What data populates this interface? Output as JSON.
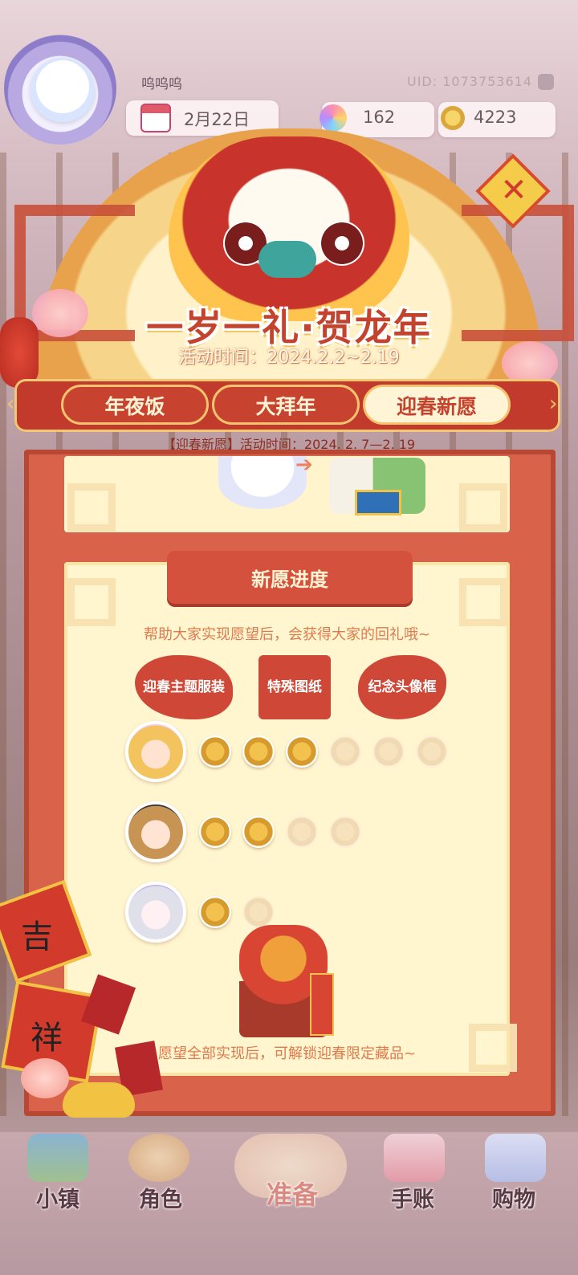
{
  "player": {
    "name": "呜呜呜",
    "uid": "UID: 1073753614"
  },
  "resources": {
    "date": "2月22日",
    "gems": "162",
    "coins": "4223"
  },
  "event": {
    "title": "一岁一礼·贺龙年",
    "time": "活动时间：2024.2.2~2.19",
    "fu_char": "✕"
  },
  "tabs": [
    {
      "label": "年夜饭",
      "active": false
    },
    {
      "label": "大拜年",
      "active": false
    },
    {
      "label": "迎春新愿",
      "active": true
    }
  ],
  "subtab": {
    "time": "【迎春新愿】活动时间：2024. 2. 7—2. 19"
  },
  "progress": {
    "title": "新愿进度",
    "help_text": "帮助大家实现愿望后，会获得大家的回礼哦~",
    "rewards": [
      "迎春主题服装",
      "特殊图纸",
      "纪念头像框"
    ],
    "characters": [
      {
        "avatar": "blonde-girl-avatar",
        "filled": 3,
        "total": 6
      },
      {
        "avatar": "brown-hair-avatar",
        "filled": 2,
        "total": 4
      },
      {
        "avatar": "silver-hair-avatar",
        "filled": 1,
        "total": 2
      }
    ],
    "final_text": "愿望全部实现后，可解锁迎春限定藏品~"
  },
  "decorations": {
    "card_ji": "吉",
    "card_xiang": "祥"
  },
  "nav": [
    {
      "label": "小镇",
      "icon": "map-icon"
    },
    {
      "label": "角色",
      "icon": "character-icon"
    },
    {
      "label": "准备",
      "icon": "wardrobe-icon"
    },
    {
      "label": "手账",
      "icon": "journal-icon"
    },
    {
      "label": "购物",
      "icon": "shopping-bag-icon"
    }
  ],
  "colors": {
    "accent_red": "#c4432e",
    "cream": "#fff6cf",
    "gold": "#f2c46f",
    "hint_text": "#e07a4e"
  }
}
